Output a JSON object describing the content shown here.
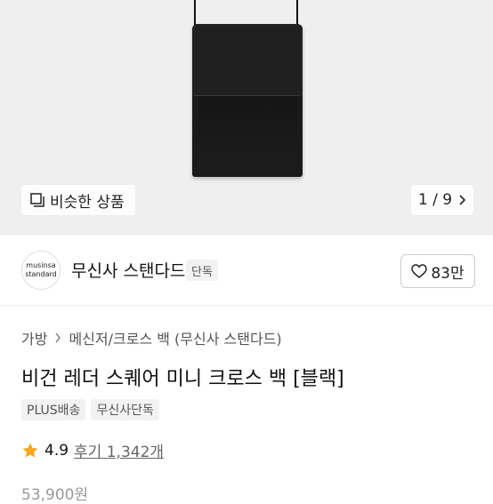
{
  "gallery": {
    "similar_label": "비슷한 상품",
    "pager_text": "1 / 9"
  },
  "brand": {
    "logo_line1": "musinsa",
    "logo_line2": "standard",
    "name": "무신사 스탠다드",
    "exclusive_tag": "단독",
    "like_count": "83만"
  },
  "breadcrumb": {
    "items": [
      "가방",
      "메신저/크로스 백 (무신사 스탠다드)"
    ]
  },
  "product": {
    "title": "비건 레더 스퀘어 미니 크로스 백 [블랙]",
    "tags": [
      "PLUS배송",
      "무신사단독"
    ],
    "rating": "4.9",
    "review_text": "후기 1,342개",
    "price_text": "53,900원"
  },
  "colors": {
    "star": "#f5a623",
    "background_gallery": "#efefef"
  }
}
